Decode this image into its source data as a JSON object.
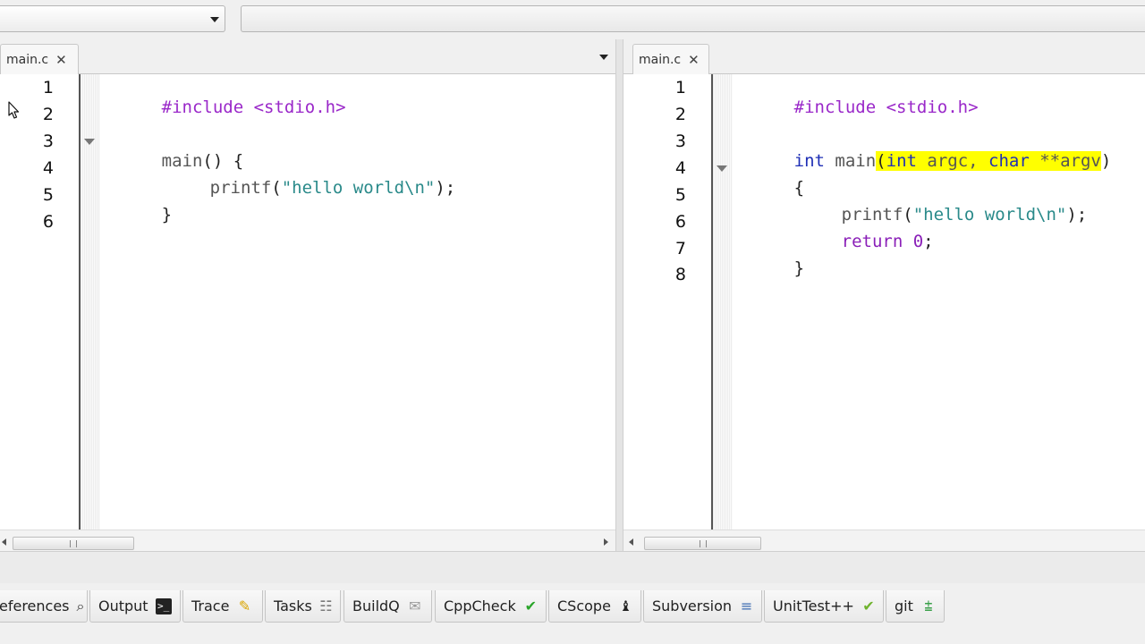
{
  "toolbar": {
    "combo_value": "",
    "search_value": ""
  },
  "left_pane": {
    "tab": {
      "label": "main.c",
      "close": "✕"
    },
    "line_numbers": [
      "1",
      "2",
      "3",
      "4",
      "5",
      "6"
    ],
    "code": {
      "l1": "#include <stdio.h>",
      "l3_fn": "main",
      "l3_rest": "() {",
      "l4_fn": "printf",
      "l4_open": "(",
      "l4_str": "\"hello world\\n\"",
      "l4_close": ");",
      "l5": "}"
    }
  },
  "right_pane": {
    "tab": {
      "label": "main.c",
      "close": "✕"
    },
    "line_numbers": [
      "1",
      "2",
      "3",
      "4",
      "5",
      "6",
      "7",
      "8"
    ],
    "code": {
      "l1": "#include <stdio.h>",
      "l3_kw": "int",
      "l3_fn": " main",
      "l3_hl_open": "(",
      "l3_hl_int": "int",
      "l3_hl_argc": " argc, ",
      "l3_hl_char": "char",
      "l3_hl_argv": " **argv",
      "l3_close": ")",
      "l4": "{",
      "l5_fn": "printf",
      "l5_open": "(",
      "l5_str": "\"hello world\\n\"",
      "l5_close": ");",
      "l6_kw": "return",
      "l6_num": " 0",
      "l6_end": ";",
      "l7": "}"
    },
    "highlight_color": "#ffff00"
  },
  "bottom_tabs": [
    {
      "label": "eferences",
      "icon": "search-icon"
    },
    {
      "label": "Output",
      "icon": "terminal-icon"
    },
    {
      "label": "Trace",
      "icon": "pencil-icon"
    },
    {
      "label": "Tasks",
      "icon": "tasks-icon"
    },
    {
      "label": "BuildQ",
      "icon": "build-queue-icon"
    },
    {
      "label": "CppCheck",
      "icon": "check-icon"
    },
    {
      "label": "CScope",
      "icon": "cscope-icon"
    },
    {
      "label": "Subversion",
      "icon": "subversion-icon"
    },
    {
      "label": "UnitTest++",
      "icon": "unittest-check-icon"
    },
    {
      "label": "git",
      "icon": "git-icon"
    }
  ],
  "colors": {
    "preprocessor": "#9a28c9",
    "keyword": "#1f2fb5",
    "string": "#2a8a8a"
  }
}
